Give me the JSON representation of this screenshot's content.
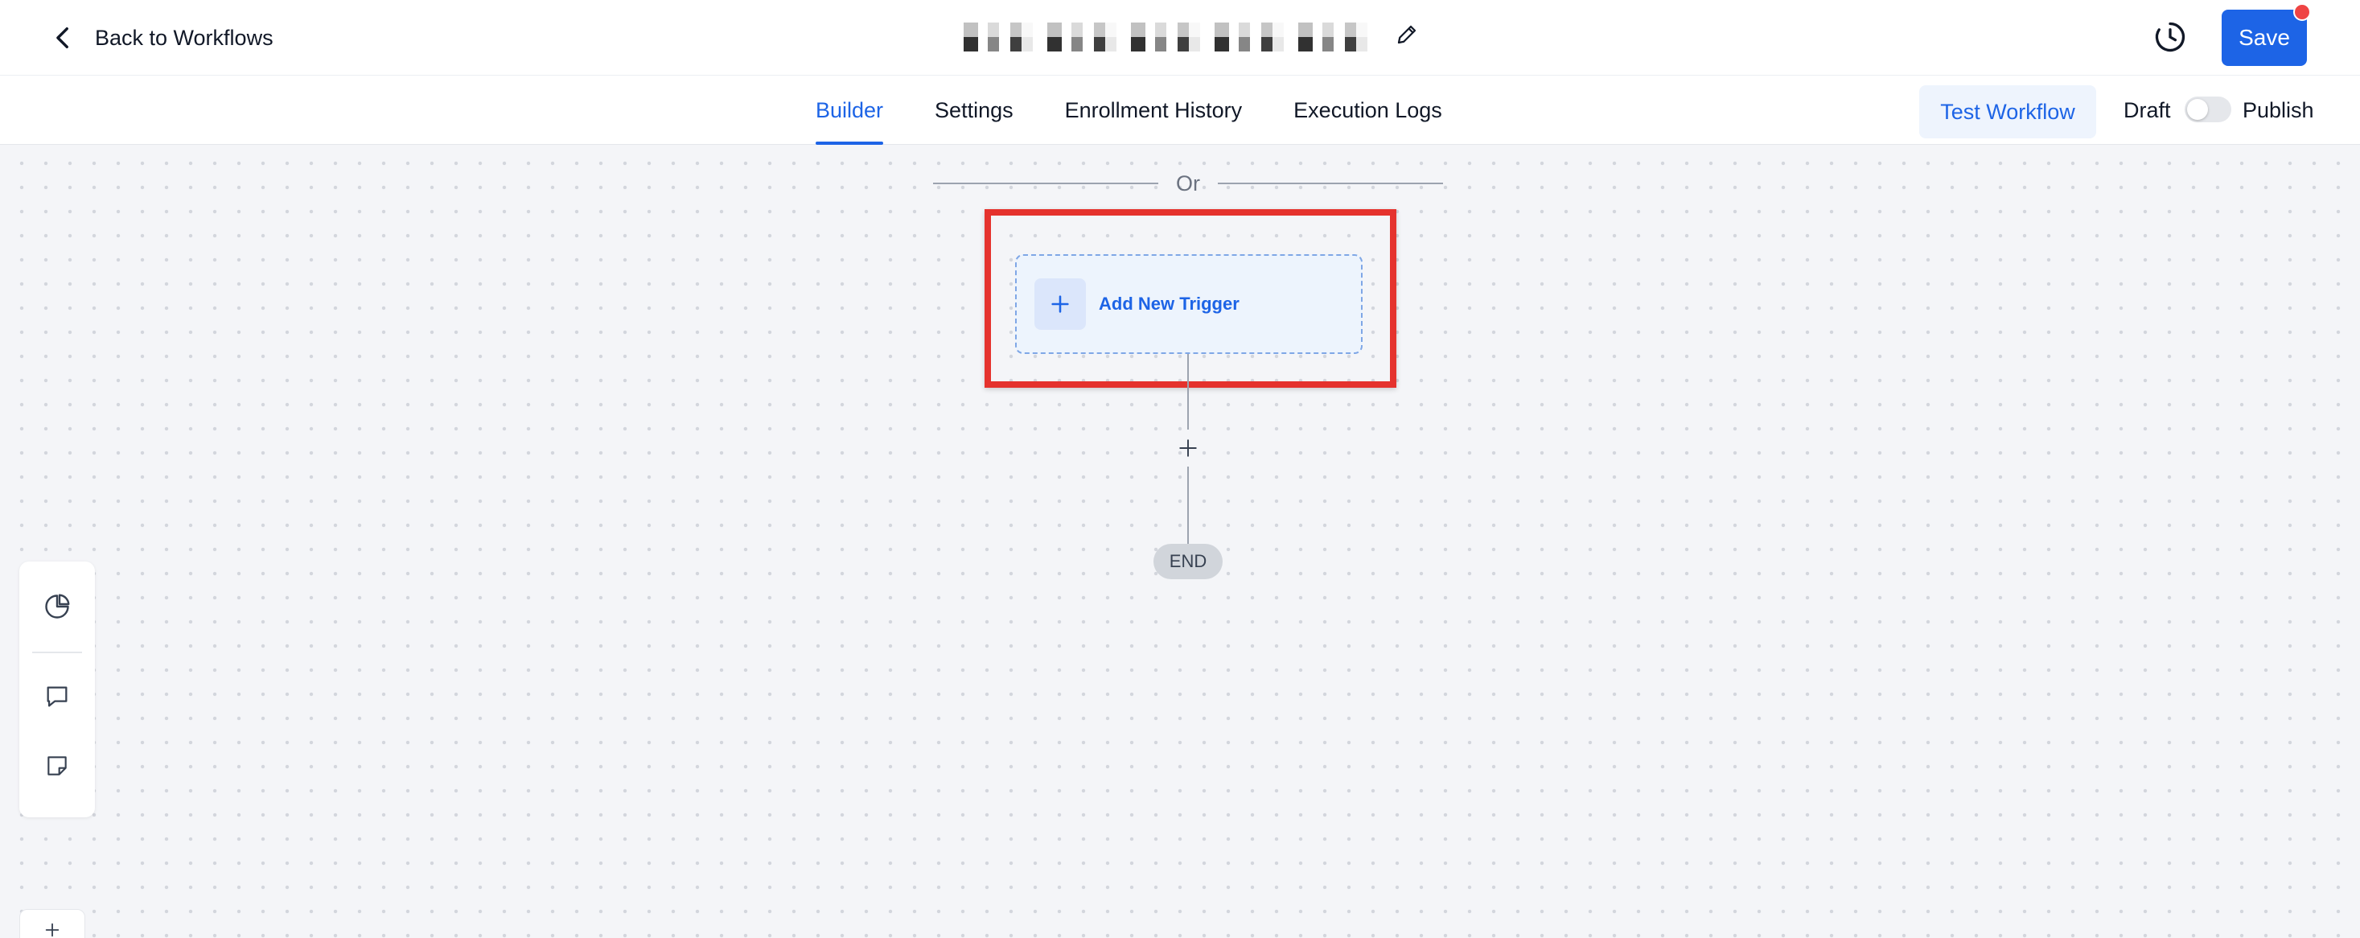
{
  "header": {
    "back_label": "Back to Workflows",
    "save_label": "Save"
  },
  "tabs": [
    {
      "label": "Builder",
      "active": true
    },
    {
      "label": "Settings",
      "active": false
    },
    {
      "label": "Enrollment History",
      "active": false
    },
    {
      "label": "Execution Logs",
      "active": false
    }
  ],
  "toolbar": {
    "test_label": "Test Workflow",
    "draft_label": "Draft",
    "publish_label": "Publish",
    "published": false
  },
  "canvas": {
    "or_label": "Or",
    "trigger_label": "Add New Trigger",
    "add_step_symbol": "+",
    "end_label": "END"
  },
  "icons": {
    "back": "chevron-left-icon",
    "edit": "pencil-icon",
    "history": "history-clock-icon",
    "analytics": "pie-chart-icon",
    "comments": "comment-icon",
    "notes": "sticky-note-icon",
    "add": "plus-icon"
  },
  "colors": {
    "accent": "#1d64e6",
    "notification": "#ef4444",
    "highlight": "#e5322d",
    "canvas_bg": "#f4f5f8"
  }
}
